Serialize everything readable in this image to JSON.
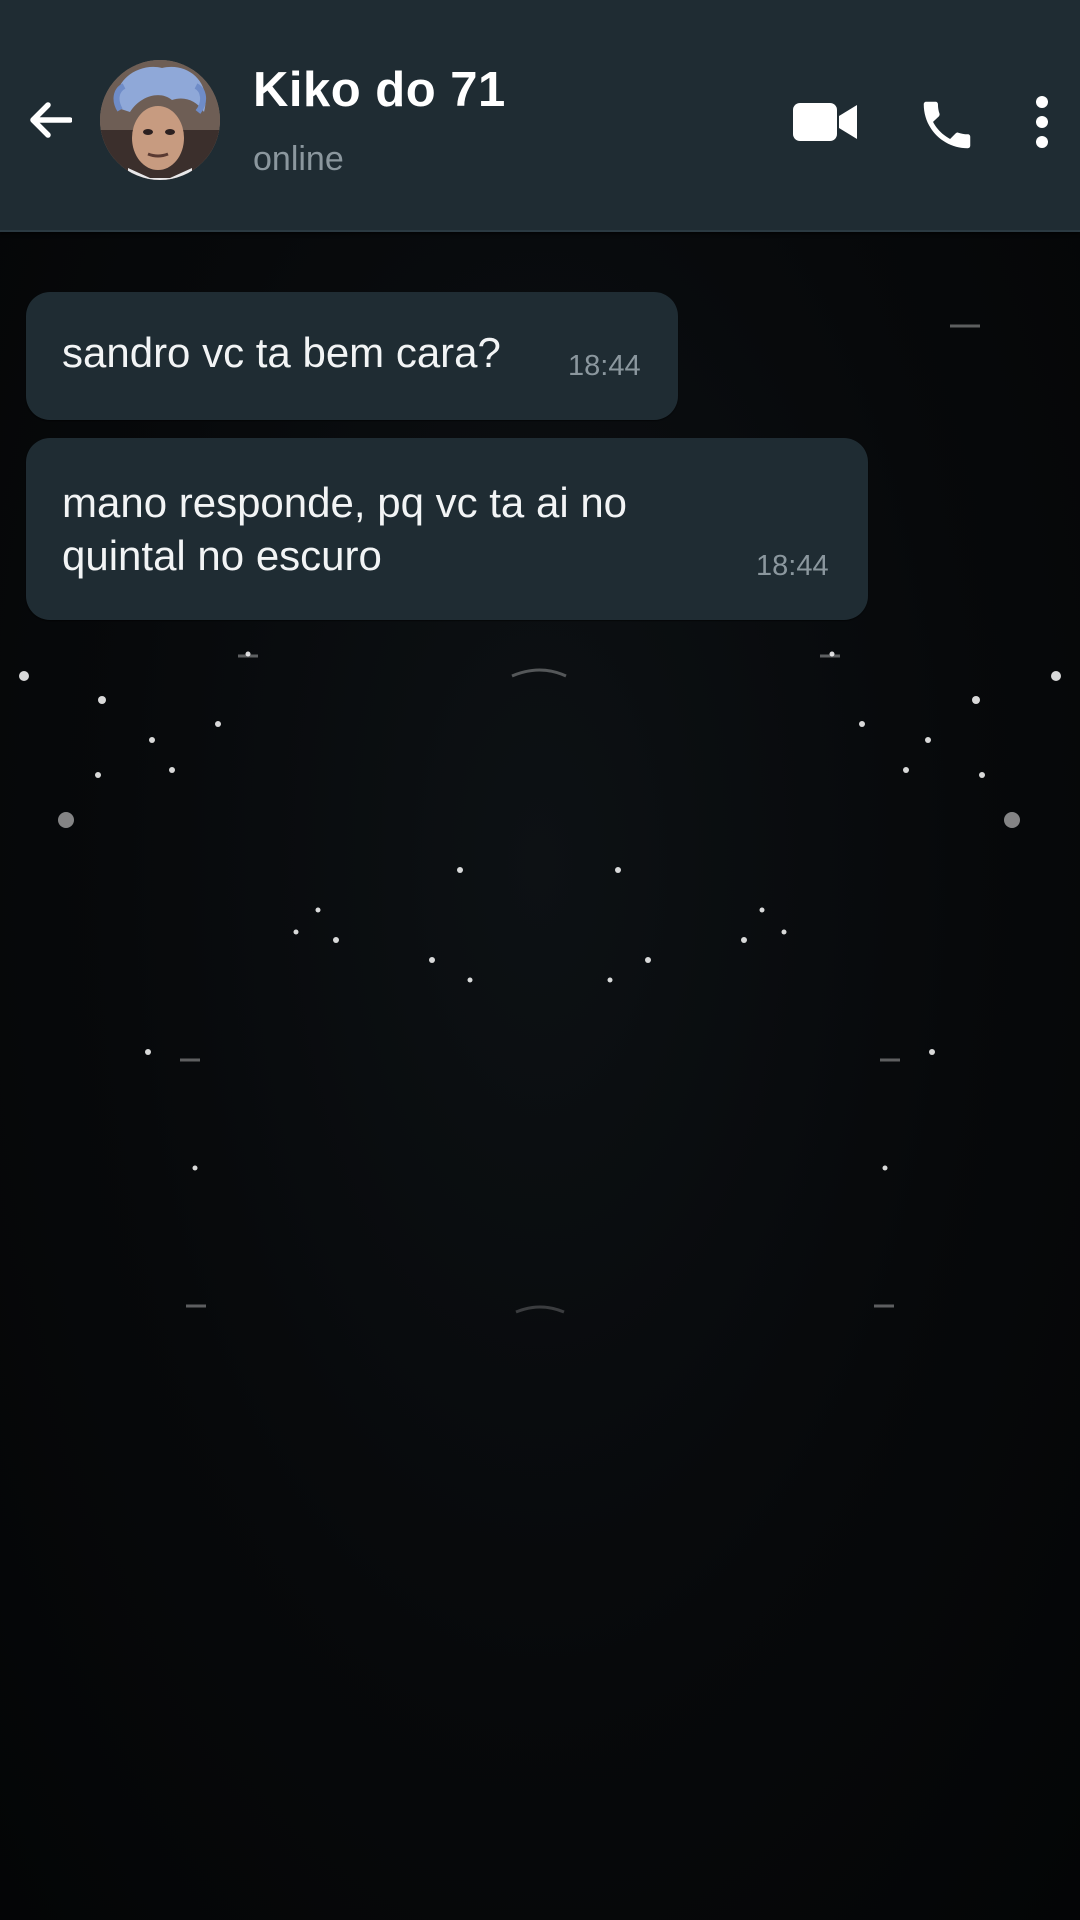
{
  "header": {
    "back_icon": "arrow-left-icon",
    "contact_name": "Kiko do 71",
    "contact_status": "online",
    "avatar_icon": "contact-avatar",
    "video_icon": "video-camera-icon",
    "call_icon": "phone-icon",
    "menu_icon": "more-vertical-icon"
  },
  "messages": [
    {
      "text": "sandro vc ta bem cara?",
      "time": "18:44",
      "direction": "incoming"
    },
    {
      "text": "mano responde, pq vc ta ai no quintal no escuro",
      "time": "18:44",
      "direction": "incoming"
    }
  ],
  "colors": {
    "header_bg": "#1f2c33",
    "bubble_bg": "#1f2c33",
    "chat_bg": "#07090b",
    "text_primary": "#ffffff",
    "text_secondary": "#8b979e"
  }
}
